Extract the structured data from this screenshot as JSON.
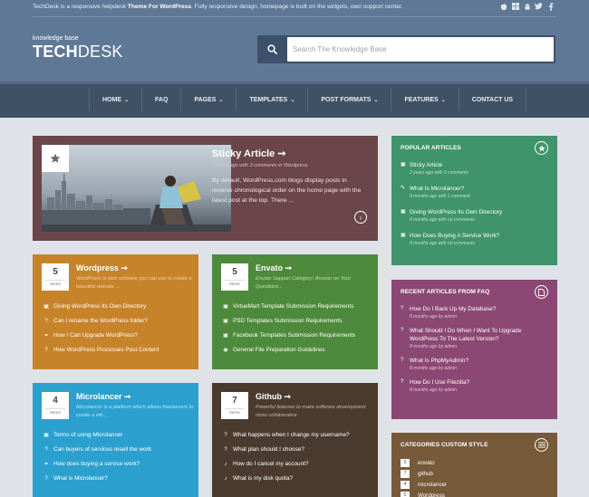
{
  "topbar": {
    "brand": "TechDesk",
    "text_mid": " is a responsive helpdesk ",
    "text_bold": "Theme For WordPress",
    "text_end": ". Fully responsive design, homepage is built on the widgets, own support center.",
    "social_icons": [
      "apple-icon",
      "windows-icon",
      "android-icon",
      "twitter-icon",
      "facebook-icon"
    ]
  },
  "logo": {
    "tagline": "knowledge base",
    "part_bold": "TECH",
    "part_light": "DESK"
  },
  "search": {
    "placeholder": "Search The Knowledge Base"
  },
  "nav": {
    "items": [
      {
        "label": "HOME",
        "dropdown": true
      },
      {
        "label": "FAQ",
        "dropdown": false
      },
      {
        "label": "PAGES",
        "dropdown": true
      },
      {
        "label": "TEMPLATES",
        "dropdown": true
      },
      {
        "label": "POST FORMATS",
        "dropdown": true
      },
      {
        "label": "FEATURES",
        "dropdown": true
      },
      {
        "label": "CONTACT US",
        "dropdown": false
      }
    ]
  },
  "sticky": {
    "title": "Sticky Article ➞",
    "meta": "2 years ago with 3 comments in Wordpress",
    "excerpt": "By default, WordPress.com blogs display posts in reverse chronological order on the home page with the latest post at the top. There ..."
  },
  "categories": [
    {
      "count": "5",
      "unit": "items",
      "title": "Wordpress ➞",
      "desc": "WordPress is web software you can use to create a beautiful website ...",
      "color": "#c7832a",
      "desc_color": "#f1d2a5",
      "items": [
        {
          "icon": "gallery-icon",
          "glyph": "▣",
          "label": "Giving WordPress Its Own Directory"
        },
        {
          "icon": "question-icon",
          "glyph": "?",
          "label": "Can I rename the WordPress folder?"
        },
        {
          "icon": "link-icon",
          "glyph": "⚭",
          "label": "How I Can Upgrade WordPress?"
        },
        {
          "icon": "question-icon",
          "glyph": "?",
          "label": "How WordPress Processes Post Content"
        }
      ]
    },
    {
      "count": "5",
      "unit": "items",
      "title": "Envato ➞",
      "desc": "Envato Support Category: Answer on Your Questions...",
      "color": "#4d8a3b",
      "desc_color": "#c3dcb9",
      "items": [
        {
          "icon": "gallery-icon",
          "glyph": "▣",
          "label": "VirtueMart Template Submission Requirements"
        },
        {
          "icon": "gallery-icon",
          "glyph": "▣",
          "label": "PSD Templates Submission Requirements"
        },
        {
          "icon": "gallery-icon",
          "glyph": "▣",
          "label": "Facebook Templates Submission Requirements"
        },
        {
          "icon": "camera-icon",
          "glyph": "◉",
          "label": "General File Preparation Guidelines"
        }
      ]
    },
    {
      "count": "4",
      "unit": "items",
      "title": "Microlancer ➞",
      "desc": "Microlancer is a platform which allows freelancers to create a vid...",
      "color": "#2ba0cf",
      "desc_color": "#bfe3f2",
      "items": [
        {
          "icon": "gallery-icon",
          "glyph": "▣",
          "label": "Terms of using Microlancer"
        },
        {
          "icon": "question-icon",
          "glyph": "?",
          "label": "Can buyers of services resell the work"
        },
        {
          "icon": "link-icon",
          "glyph": "⚭",
          "label": "How does buying a service work?"
        },
        {
          "icon": "question-icon",
          "glyph": "?",
          "label": "What is Microlancer?"
        }
      ]
    },
    {
      "count": "7",
      "unit": "items",
      "title": "Github ➞",
      "desc": "Powerful features to make software development more collaborative",
      "color": "#4b3b2e",
      "desc_color": "#c8b8a8",
      "items": [
        {
          "icon": "question-icon",
          "glyph": "?",
          "label": "What happens when I change my username?"
        },
        {
          "icon": "question-icon",
          "glyph": "?",
          "label": "What plan should I choose?"
        },
        {
          "icon": "music-icon",
          "glyph": "♪",
          "label": "How do I cancel my account?"
        },
        {
          "icon": "music-icon",
          "glyph": "♪",
          "label": "What is my disk quota?"
        }
      ]
    }
  ],
  "popular": {
    "title": "POPULAR ARTICLES",
    "icon": "star-icon",
    "items": [
      {
        "icon": "gallery-icon",
        "glyph": "▣",
        "label": "Sticky Article",
        "meta": "2 years ago with 3 comments"
      },
      {
        "icon": "pencil-icon",
        "glyph": "✎",
        "label": "What Is Microlancer?",
        "meta": "8 months ago with 1 comment"
      },
      {
        "icon": "gallery-icon",
        "glyph": "▣",
        "label": "Giving WordPress Its Own Directory",
        "meta": "8 months ago with no comments"
      },
      {
        "icon": "gallery-icon",
        "glyph": "▣",
        "label": "How Does Buying A Service Work?",
        "meta": "8 months ago with no comments"
      }
    ]
  },
  "recent": {
    "title": "RECENT ARTICLES FROM FAQ",
    "icon": "document-icon",
    "items": [
      {
        "icon": "question-icon",
        "glyph": "?",
        "label": "How Do I Back Up My Database?",
        "meta": "8 months ago by admin"
      },
      {
        "icon": "question-icon",
        "glyph": "?",
        "label": "What Should I Do When I Want To Upgrade WordPress To The Latest Version?",
        "meta": "8 months ago by admin"
      },
      {
        "icon": "question-icon",
        "glyph": "?",
        "label": "What Is PhpMyAdmin?",
        "meta": "8 months ago by admin"
      },
      {
        "icon": "question-icon",
        "glyph": "?",
        "label": "How Do I Use Filezilla?",
        "meta": "8 months ago by admin"
      }
    ]
  },
  "custom": {
    "title": "CATEGORIES CUSTOM STYLE",
    "icon": "list-icon",
    "items": [
      {
        "badge": "5",
        "label": "envato"
      },
      {
        "badge": "7",
        "label": "github"
      },
      {
        "badge": "4",
        "label": "microlancer"
      },
      {
        "badge": "5",
        "label": "Wordpress"
      }
    ]
  }
}
